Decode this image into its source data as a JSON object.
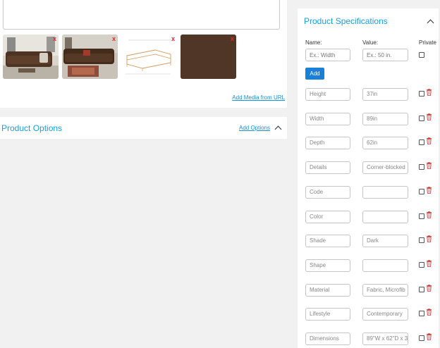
{
  "media": {
    "add_media_label": "Add Media from URL",
    "thumbnails": [
      {
        "icon": "sofa-room-photo",
        "remove": "x"
      },
      {
        "icon": "sofa-room-photo",
        "remove": "x"
      },
      {
        "icon": "sofa-dimension-drawing",
        "remove": "x"
      },
      {
        "icon": "fabric-swatch-photo",
        "remove": "x"
      }
    ]
  },
  "options": {
    "title": "Product Options",
    "add_label": "Add Options"
  },
  "specs": {
    "title": "Product Specifications",
    "name_label": "Name:",
    "value_label": "Value:",
    "private_label": "Private",
    "name_placeholder": "Ex.: Width",
    "value_placeholder": "Ex.: 50 in.",
    "add_label": "Add",
    "rows": [
      {
        "name": "Height",
        "value": "37in"
      },
      {
        "name": "Width",
        "value": "89in"
      },
      {
        "name": "Depth",
        "value": "62in"
      },
      {
        "name": "Details",
        "value": "Corner-blocked"
      },
      {
        "name": "Code",
        "value": ""
      },
      {
        "name": "Color",
        "value": ""
      },
      {
        "name": "Shade",
        "value": "Dark"
      },
      {
        "name": "Shape",
        "value": ""
      },
      {
        "name": "Material",
        "value": "Fabric, Microfib"
      },
      {
        "name": "Lifestyle",
        "value": "Contemporary"
      },
      {
        "name": "Dimensions",
        "value": "89\"W x 62\"D x 3"
      }
    ]
  },
  "colors": {
    "accent": "#1a9fd6",
    "button": "#1a7fd6",
    "delete": "#d32f2f"
  }
}
